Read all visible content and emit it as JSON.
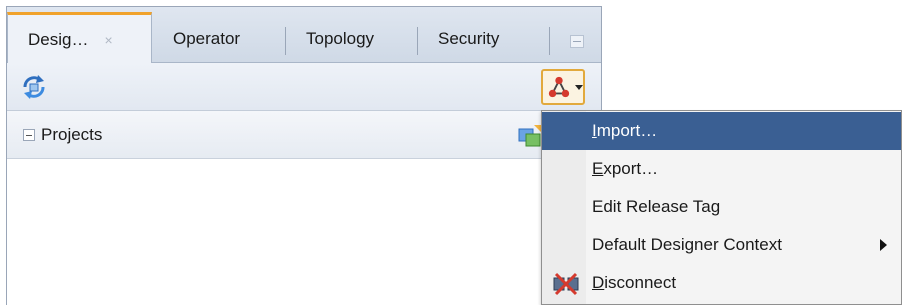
{
  "tabs": [
    {
      "label": "Desig…",
      "close": "×",
      "active": true
    },
    {
      "label": "Operator",
      "active": false
    },
    {
      "label": "Topology",
      "active": false
    },
    {
      "label": "Security",
      "active": false
    }
  ],
  "toolbar": {
    "refresh_icon": "refresh-icon",
    "connect_icon": "connect-navigator-icon"
  },
  "section": {
    "label": "Projects",
    "tool_icon": "project-actions-icon"
  },
  "menu": {
    "items": [
      {
        "label": "Import…",
        "mnemonic": "I",
        "rest": "mport…",
        "selected": true
      },
      {
        "label": "Export…",
        "mnemonic": "E",
        "rest": "xport…",
        "selected": false
      },
      {
        "label": "Edit Release Tag",
        "selected": false
      },
      {
        "label": "Default Designer Context",
        "submenu": true,
        "selected": false
      },
      {
        "label": "Disconnect",
        "mnemonic": "D",
        "rest": "isconnect",
        "icon": "disconnect-icon",
        "selected": false
      }
    ]
  },
  "colors": {
    "accent": "#f0a22b",
    "selection": "#3a5f93"
  }
}
